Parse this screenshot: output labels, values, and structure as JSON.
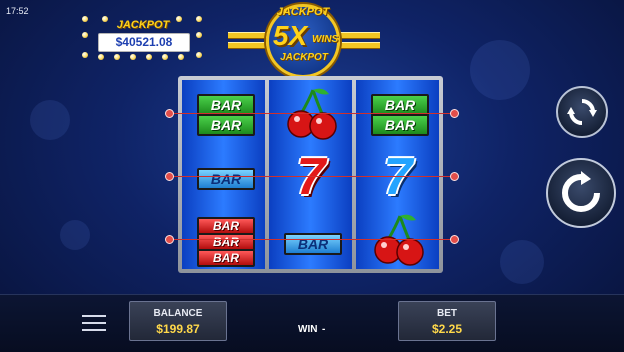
{
  "status": {
    "time": "17:52"
  },
  "jackpot": {
    "label": "JACKPOT",
    "value": "$40521.08"
  },
  "logo": {
    "top": "JACKPOT",
    "mid": "5X",
    "wins": "WINS",
    "bottom": "JACKPOT"
  },
  "reels": {
    "reel1": {
      "top": [
        "BAR",
        "BAR"
      ],
      "middle": [
        "BAR"
      ],
      "bottom": [
        "BAR",
        "BAR",
        "BAR"
      ]
    },
    "reel2": {
      "top": "cherry",
      "middle": "7",
      "bottom": [
        "BAR"
      ]
    },
    "reel3": {
      "top": [
        "BAR",
        "BAR"
      ],
      "middle": "7",
      "bottom": "cherry"
    }
  },
  "controls": {
    "balance_label": "BALANCE",
    "balance_value": "$199.87",
    "win_label": "WIN",
    "win_value": "-",
    "bet_label": "BET",
    "bet_value": "$2.25"
  },
  "colors": {
    "accent_gold": "#ffd21a",
    "payline_red": "#d0302c",
    "value_yellow": "#ffd84a"
  },
  "icons": {
    "menu": "hamburger-icon",
    "autoplay": "autoplay-icon",
    "spin": "spin-icon"
  }
}
